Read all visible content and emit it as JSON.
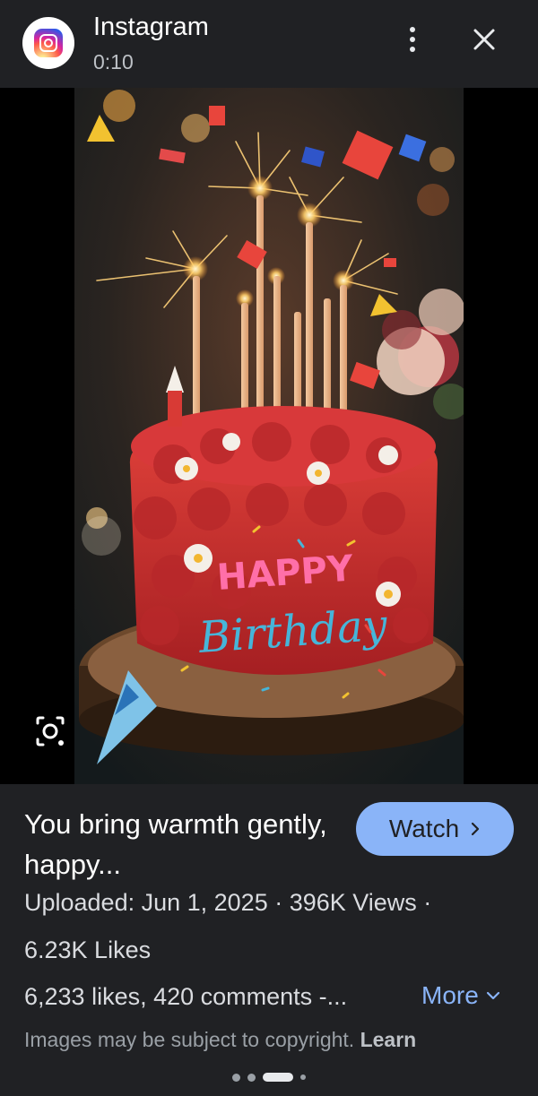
{
  "header": {
    "source_name": "Instagram",
    "duration": "0:10",
    "logo_icon": "instagram-logo-icon",
    "more_icon": "more-vert-icon",
    "close_icon": "close-icon"
  },
  "media": {
    "image_caption_text": [
      "HAPPY",
      "Birthday"
    ],
    "lens_icon": "google-lens-icon"
  },
  "info": {
    "title": "You bring warmth gently, happy...",
    "watch_label": "Watch",
    "uploaded_text": "Uploaded: Jun 1, 2025 · 396K Views ·",
    "likes_text": "6.23K Likes",
    "stats_text": "6,233 likes, 420 comments -...",
    "more_label": "More",
    "copyright_text": "Images may be subject to copyright.",
    "learn_label": "Learn"
  },
  "colors": {
    "background": "#202124",
    "accent_blue": "#8ab4f8",
    "text_primary": "#ffffff",
    "text_secondary": "#9aa0a6"
  }
}
